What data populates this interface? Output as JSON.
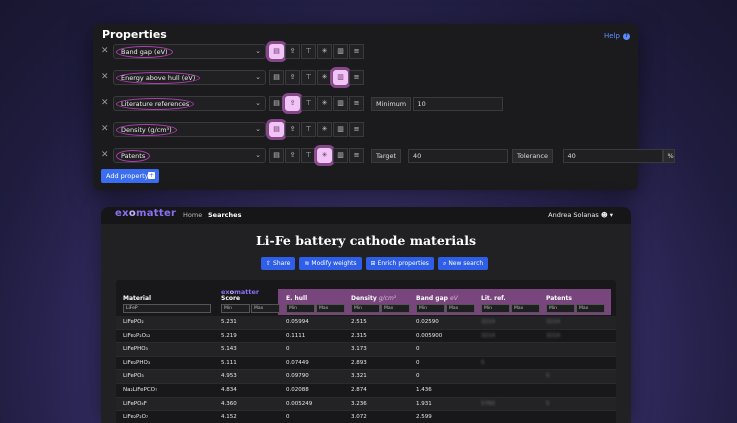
{
  "props": {
    "title": "Properties",
    "help": "Help",
    "add_label": "Add property",
    "rows": [
      {
        "label": "Band gap (eV)",
        "hl": 0,
        "extra": []
      },
      {
        "label": "Energy above hull (eV)",
        "hl": 4,
        "extra": []
      },
      {
        "label": "Literature references",
        "hl": 1,
        "extra": [
          {
            "type": "label",
            "text": "Minimum"
          },
          {
            "type": "field",
            "text": "10"
          }
        ]
      },
      {
        "label": "Density (g/cm³)",
        "hl": 0,
        "extra": []
      },
      {
        "label": "Patents",
        "hl": 3,
        "extra": [
          {
            "type": "label",
            "text": "Target"
          },
          {
            "type": "field",
            "text": "40"
          },
          {
            "type": "label",
            "text": "Tolerance"
          },
          {
            "type": "field",
            "text": "40"
          },
          {
            "type": "unit",
            "text": "%"
          }
        ]
      }
    ],
    "icons": [
      "document-icon",
      "upload-icon",
      "align-top-icon",
      "cross-arrows-icon",
      "file-icon",
      "sliders-icon"
    ]
  },
  "app": {
    "logo_a": "ex",
    "logo_o": "o",
    "logo_b": "matter",
    "nav": [
      "Home",
      "Searches"
    ],
    "user": "Andrea Solanas",
    "title": "Li-Fe battery cathode materials",
    "actions": [
      {
        "icon": "⇧",
        "label": "Share"
      },
      {
        "icon": "≋",
        "label": "Modify weights"
      },
      {
        "icon": "⊞",
        "label": "Enrich properties"
      },
      {
        "icon": "⌕",
        "label": "New search"
      }
    ]
  },
  "table": {
    "headers": {
      "material": "Material",
      "score": "Score",
      "ehull": "E. hull",
      "density": "Density",
      "density_unit": "g/cm³",
      "bandgap": "Band gap",
      "bandgap_unit": "eV",
      "litref": "Lit. ref.",
      "patents": "Patents"
    },
    "filter_value": "LiFeP",
    "min": "Min",
    "max": "Max",
    "rows": [
      {
        "material": "LiFePO₂",
        "score": "5.231",
        "ehull": "0.05994",
        "density": "2.515",
        "bandgap": "0.02590",
        "litref": "3214",
        "patents": "3214"
      },
      {
        "material": "LiFe₂P₂O₁₂",
        "score": "5.219",
        "ehull": "0.1111",
        "density": "2.315",
        "bandgap": "0.005900",
        "litref": "3214",
        "patents": "3214"
      },
      {
        "material": "LiFePHO₃",
        "score": "5.143",
        "ehull": "0",
        "density": "3.173",
        "bandgap": "0",
        "litref": "",
        "patents": ""
      },
      {
        "material": "LiFe₂PHO₃",
        "score": "5.111",
        "ehull": "0.07449",
        "density": "2.893",
        "bandgap": "0",
        "litref": "5",
        "patents": ""
      },
      {
        "material": "LiFePO₃",
        "score": "4.953",
        "ehull": "0.09790",
        "density": "3.321",
        "bandgap": "0",
        "litref": "",
        "patents": "5"
      },
      {
        "material": "Na₂LiFePCO₇",
        "score": "4.834",
        "ehull": "0.02088",
        "density": "2.874",
        "bandgap": "1.436",
        "litref": "",
        "patents": ""
      },
      {
        "material": "LiFePO₄F",
        "score": "4.360",
        "ehull": "0.005249",
        "density": "3.236",
        "bandgap": "1.931",
        "litref": "5760",
        "patents": "5"
      },
      {
        "material": "LiFe₂P₂O₇",
        "score": "4.152",
        "ehull": "0",
        "density": "3.072",
        "bandgap": "2.599",
        "litref": "",
        "patents": ""
      }
    ]
  },
  "colors": {
    "accent": "#3a6df0",
    "highlight": "#f0c4f4",
    "ring": "#b03fb3",
    "brand": "#8c6ff0"
  }
}
